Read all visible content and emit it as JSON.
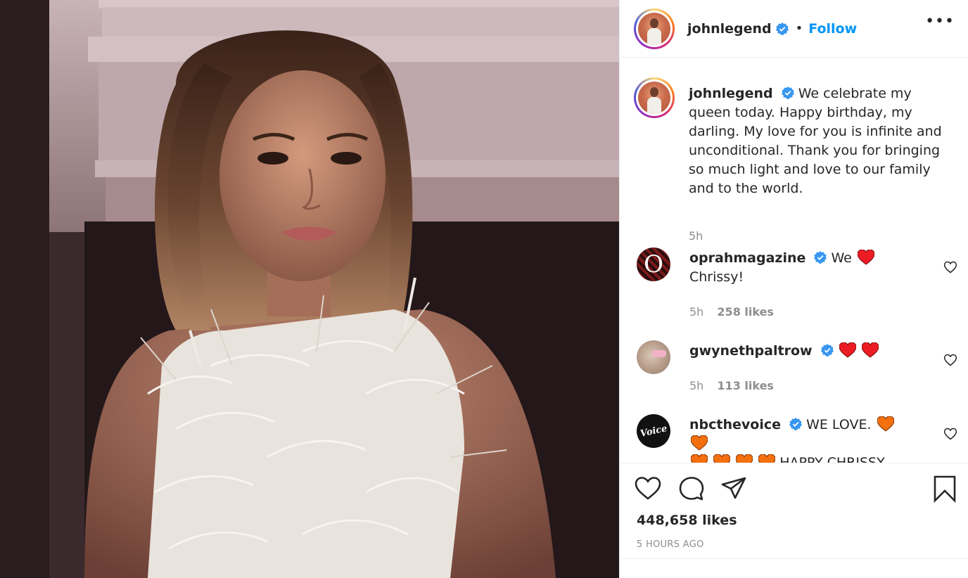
{
  "post": {
    "author": "johnlegend",
    "follow_label": "Follow",
    "separator": "•",
    "more_label": "•••"
  },
  "caption": {
    "username": "johnlegend",
    "text": "We celebrate my queen today. Happy birthday, my darling. My love for you is infinite and unconditional. Thank you for bringing so much light and love to our family and to the world.",
    "time": "5h"
  },
  "comments": [
    {
      "username": "oprahmagazine",
      "text_before": "We",
      "text_after": "Chrissy!",
      "time": "5h",
      "likes": "258 likes"
    },
    {
      "username": "gwynethpaltrow",
      "text_before": "",
      "text_after": "",
      "time": "5h",
      "likes": "113 likes"
    },
    {
      "username": "nbcthevoice",
      "text_before": "WE LOVE.",
      "text_after": "HAPPY CHRISSY",
      "time": "",
      "likes": ""
    }
  ],
  "footer": {
    "likes": "448,658 likes",
    "time_ago": "5 HOURS AGO"
  },
  "colors": {
    "link": "#0095f6",
    "verified": "#3897f0",
    "red_heart": "#ed1c24",
    "orange_heart": "#f4700f",
    "muted": "#8e8e8e"
  },
  "icons": [
    "verified-badge-icon",
    "more-options-icon",
    "heart-outline-icon",
    "comment-icon",
    "share-icon",
    "bookmark-icon",
    "red-heart-emoji",
    "orange-heart-emoji"
  ]
}
